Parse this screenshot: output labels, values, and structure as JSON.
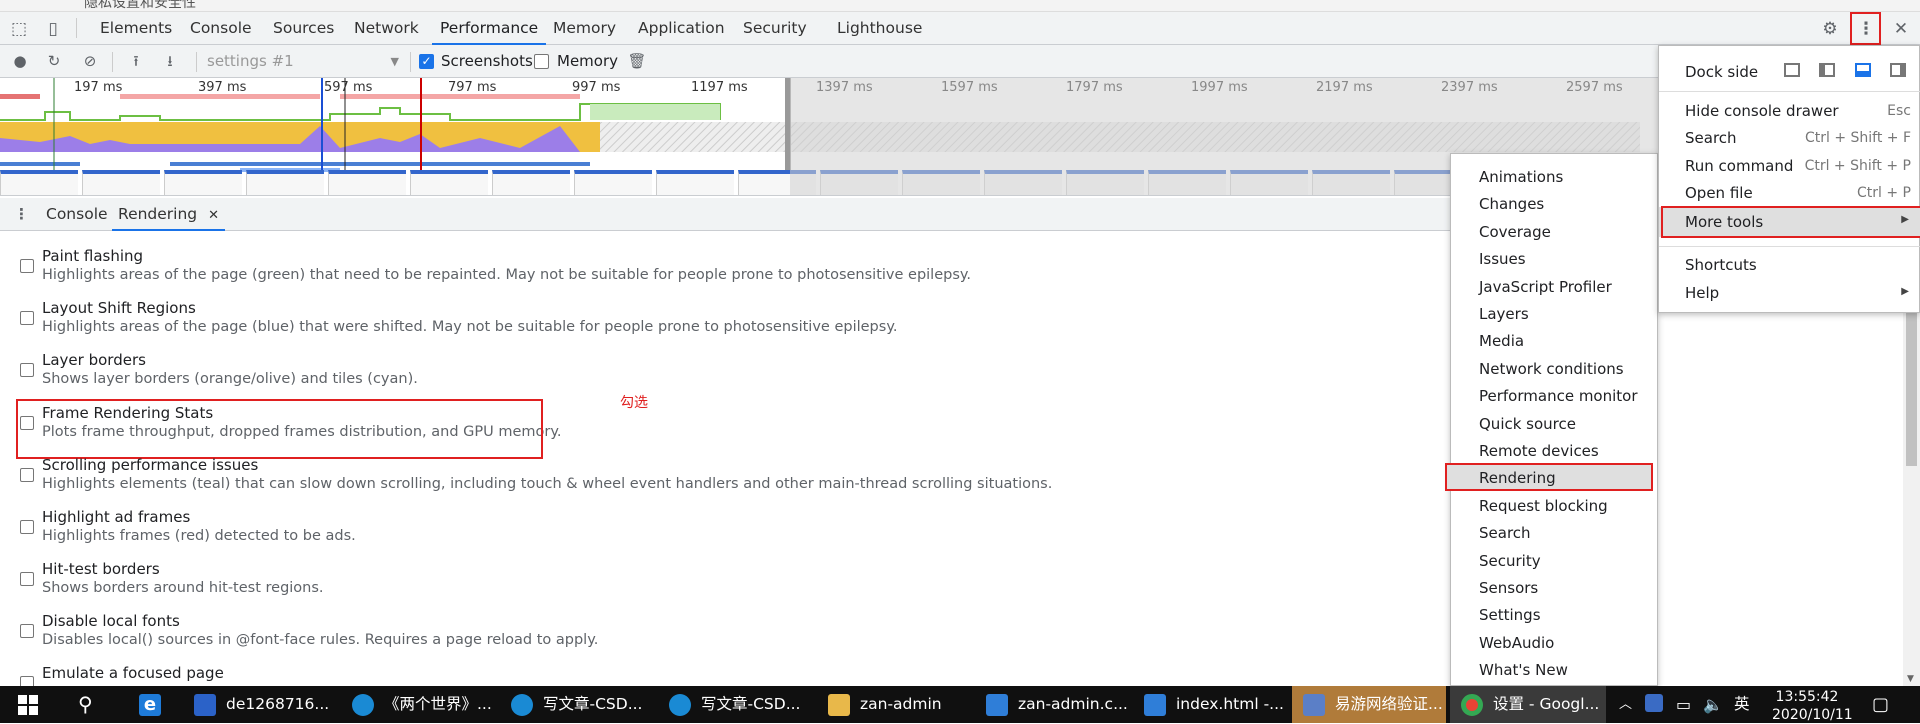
{
  "top_strip": {
    "text": "隐私设置和安全性"
  },
  "devtools_tabs": [
    "Elements",
    "Console",
    "Sources",
    "Network",
    "Performance",
    "Memory",
    "Application",
    "Security",
    "Lighthouse"
  ],
  "toolbar": {
    "profile_select": "settings #1",
    "screenshots_label": "Screenshots",
    "memory_label": "Memory"
  },
  "timeline": {
    "ticks": [
      "197 ms",
      "397 ms",
      "597 ms",
      "797 ms",
      "997 ms",
      "1197 ms",
      "1397 ms",
      "1597 ms",
      "1797 ms",
      "1997 ms",
      "2197 ms",
      "2397 ms",
      "2597 ms"
    ]
  },
  "drawer": {
    "tabs": [
      "Console",
      "Rendering"
    ],
    "close_glyph": "✕"
  },
  "rendering_options": [
    {
      "title": "Paint flashing",
      "desc": "Highlights areas of the page (green) that need to be repainted. May not be suitable for people prone to photosensitive epilepsy."
    },
    {
      "title": "Layout Shift Regions",
      "desc": "Highlights areas of the page (blue) that were shifted. May not be suitable for people prone to photosensitive epilepsy."
    },
    {
      "title": "Layer borders",
      "desc": "Shows layer borders (orange/olive) and tiles (cyan)."
    },
    {
      "title": "Frame Rendering Stats",
      "desc": "Plots frame throughput, dropped frames distribution, and GPU memory."
    },
    {
      "title": "Scrolling performance issues",
      "desc": "Highlights elements (teal) that can slow down scrolling, including touch & wheel event handlers and other main-thread scrolling situations."
    },
    {
      "title": "Highlight ad frames",
      "desc": "Highlights frames (red) detected to be ads."
    },
    {
      "title": "Hit-test borders",
      "desc": "Shows borders around hit-test regions."
    },
    {
      "title": "Disable local fonts",
      "desc": "Disables local() sources in @font-face rules. Requires a page reload to apply."
    },
    {
      "title": "Emulate a focused page",
      "desc": ""
    }
  ],
  "annotation": "勾选",
  "more_tools": [
    "Animations",
    "Changes",
    "Coverage",
    "Issues",
    "JavaScript Profiler",
    "Layers",
    "Media",
    "Network conditions",
    "Performance monitor",
    "Quick source",
    "Remote devices",
    "Rendering",
    "Request blocking",
    "Search",
    "Security",
    "Sensors",
    "Settings",
    "WebAudio",
    "What's New"
  ],
  "main_menu": {
    "dock_side": "Dock side",
    "items": [
      {
        "label": "Hide console drawer",
        "shortcut": "Esc"
      },
      {
        "label": "Search",
        "shortcut": "Ctrl + Shift + F"
      },
      {
        "label": "Run command",
        "shortcut": "Ctrl + Shift + P"
      },
      {
        "label": "Open file",
        "shortcut": "Ctrl + P"
      },
      {
        "label": "More tools",
        "shortcut": ""
      },
      {
        "label": "Shortcuts",
        "shortcut": ""
      },
      {
        "label": "Help",
        "shortcut": ""
      }
    ]
  },
  "taskbar": {
    "items": [
      "de1268716...",
      "《两个世界》...",
      "写文章-CSD...",
      "写文章-CSD...",
      "zan-admin",
      "zan-admin.c...",
      "index.html -...",
      "易游网络验证...",
      "设置 - Googl..."
    ],
    "ime": "英",
    "time": "13:55:42",
    "date": "2020/10/11"
  },
  "colors": {
    "accent": "#1a73e8",
    "annotation_red": "#e02020",
    "fps_green": "#8bc34a",
    "scripting_yellow": "#f0c040",
    "rendering_purple": "#9c7ee8"
  }
}
